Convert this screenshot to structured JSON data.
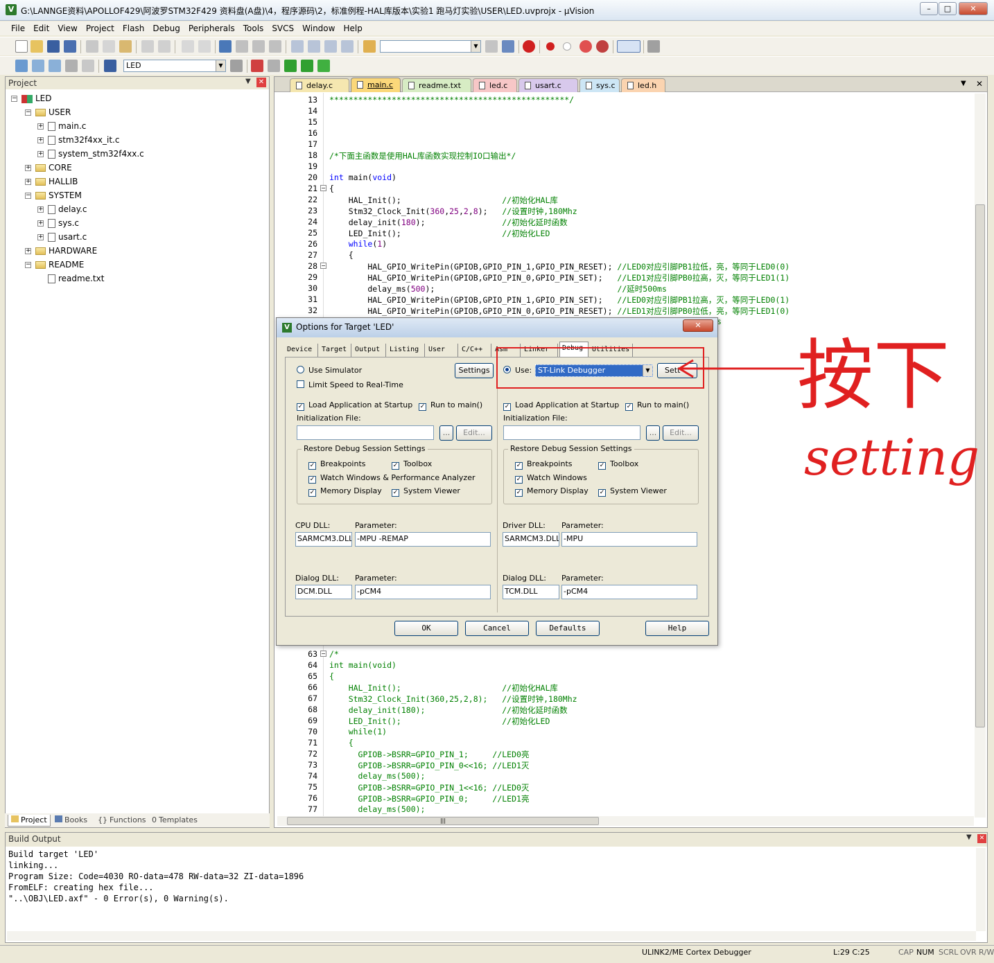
{
  "window": {
    "title": "G:\\LANNGE资料\\APOLLOF429\\阿波罗STM32F429 资料盘(A盘)\\4，程序源码\\2，标准例程-HAL库版本\\实验1 跑马灯实验\\USER\\LED.uvprojx - µVision",
    "icon": "V"
  },
  "menu": [
    "File",
    "Edit",
    "View",
    "Project",
    "Flash",
    "Debug",
    "Peripherals",
    "Tools",
    "SVCS",
    "Window",
    "Help"
  ],
  "toolbar2": {
    "target": "LED"
  },
  "project": {
    "header": "Project",
    "tree": [
      {
        "label": "LED",
        "level": 0,
        "type": "root"
      },
      {
        "label": "USER",
        "level": 1,
        "type": "folder-open"
      },
      {
        "label": "main.c",
        "level": 2,
        "type": "file"
      },
      {
        "label": "stm32f4xx_it.c",
        "level": 2,
        "type": "file"
      },
      {
        "label": "system_stm32f4xx.c",
        "level": 2,
        "type": "file"
      },
      {
        "label": "CORE",
        "level": 1,
        "type": "folder"
      },
      {
        "label": "HALLIB",
        "level": 1,
        "type": "folder"
      },
      {
        "label": "SYSTEM",
        "level": 1,
        "type": "folder-open"
      },
      {
        "label": "delay.c",
        "level": 2,
        "type": "file"
      },
      {
        "label": "sys.c",
        "level": 2,
        "type": "file"
      },
      {
        "label": "usart.c",
        "level": 2,
        "type": "file"
      },
      {
        "label": "HARDWARE",
        "level": 1,
        "type": "folder"
      },
      {
        "label": "README",
        "level": 1,
        "type": "folder-open"
      },
      {
        "label": "readme.txt",
        "level": 2,
        "type": "file-plain"
      }
    ],
    "tabs": [
      "Project",
      "Books",
      "Functions",
      "Templates"
    ]
  },
  "editor": {
    "tabs": [
      {
        "label": "delay.c",
        "color": "#f5e7b0"
      },
      {
        "label": "main.c",
        "color": "#fbd87a",
        "active": true
      },
      {
        "label": "readme.txt",
        "color": "#d7ecc4"
      },
      {
        "label": "led.c",
        "color": "#f7c7c7"
      },
      {
        "label": "usart.c",
        "color": "#d8c9ec"
      },
      {
        "label": "sys.c",
        "color": "#cde6f5"
      },
      {
        "label": "led.h",
        "color": "#fbd4b0"
      }
    ],
    "lines_top": [
      {
        "n": "13",
        "t": "**************************************************/",
        "c": "cm"
      },
      {
        "n": "14",
        "t": ""
      },
      {
        "n": "15",
        "t": ""
      },
      {
        "n": "16",
        "t": ""
      },
      {
        "n": "17",
        "t": ""
      },
      {
        "n": "18",
        "t": "/*下面主函数是使用HAL库函数实现控制IO口输出*/",
        "c": "cm"
      },
      {
        "n": "19",
        "t": ""
      },
      {
        "n": "20",
        "t": "int main(void)"
      },
      {
        "n": "21",
        "t": "{"
      },
      {
        "n": "22",
        "t": "    HAL_Init();                     //初始化HAL库"
      },
      {
        "n": "23",
        "t": "    Stm32_Clock_Init(360,25,2,8);   //设置时钟,180Mhz"
      },
      {
        "n": "24",
        "t": "    delay_init(180);                //初始化延时函数"
      },
      {
        "n": "25",
        "t": "    LED_Init();                     //初始化LED"
      },
      {
        "n": "26",
        "t": "    while(1)"
      },
      {
        "n": "27",
        "t": "    {"
      },
      {
        "n": "28",
        "t": "        HAL_GPIO_WritePin(GPIOB,GPIO_PIN_1,GPIO_PIN_RESET); //LED0对应引脚PB1拉低，亮，等同于LED0(0)"
      },
      {
        "n": "29",
        "t": "        HAL_GPIO_WritePin(GPIOB,GPIO_PIN_0,GPIO_PIN_SET);   //LED1对应引脚PB0拉高，灭，等同于LED1(1)"
      },
      {
        "n": "30",
        "t": "        delay_ms(500);                                      //延时500ms"
      },
      {
        "n": "31",
        "t": "        HAL_GPIO_WritePin(GPIOB,GPIO_PIN_1,GPIO_PIN_SET);   //LED0对应引脚PB1拉高，灭，等同于LED0(1)"
      },
      {
        "n": "32",
        "t": "        HAL_GPIO_WritePin(GPIOB,GPIO_PIN_0,GPIO_PIN_RESET); //LED1对应引脚PB0拉低，亮，等同于LED1(0)"
      }
    ],
    "lines_bottom": [
      {
        "n": "63",
        "t": "/*",
        "c": "cm"
      },
      {
        "n": "64",
        "t": "int main(void)",
        "c": "cm"
      },
      {
        "n": "65",
        "t": "{",
        "c": "cm"
      },
      {
        "n": "66",
        "t": "    HAL_Init();                     //初始化HAL库",
        "c": "cm"
      },
      {
        "n": "67",
        "t": "    Stm32_Clock_Init(360,25,2,8);   //设置时钟,180Mhz",
        "c": "cm"
      },
      {
        "n": "68",
        "t": "    delay_init(180);                //初始化延时函数",
        "c": "cm"
      },
      {
        "n": "69",
        "t": "    LED_Init();                     //初始化LED",
        "c": "cm"
      },
      {
        "n": "70",
        "t": "    while(1)",
        "c": "cm"
      },
      {
        "n": "71",
        "t": "    {",
        "c": "cm"
      },
      {
        "n": "72",
        "t": "      GPIOB->BSRR=GPIO_PIN_1;     //LED0亮",
        "c": "cm"
      },
      {
        "n": "73",
        "t": "      GPIOB->BSRR=GPIO_PIN_0<<16; //LED1灭",
        "c": "cm"
      },
      {
        "n": "74",
        "t": "      delay_ms(500);",
        "c": "cm"
      },
      {
        "n": "75",
        "t": "      GPIOB->BSRR=GPIO_PIN_1<<16; //LED0灭",
        "c": "cm"
      },
      {
        "n": "76",
        "t": "      GPIOB->BSRR=GPIO_PIN_0;     //LED1亮",
        "c": "cm"
      },
      {
        "n": "77",
        "t": "      delay_ms(500);",
        "c": "cm"
      }
    ],
    "overflow_fragment": "s"
  },
  "dialog": {
    "title": "Options for Target 'LED'",
    "close": "✕",
    "tabs": [
      "Device",
      "Target",
      "Output",
      "Listing",
      "User",
      "C/C++",
      "Asm",
      "Linker",
      "Debug",
      "Utilities"
    ],
    "left": {
      "use_simulator": "Use Simulator",
      "settings": "Settings",
      "limit_speed": "Limit Speed to Real-Time",
      "load_app": "Load Application at Startup",
      "run_to_main": "Run to main()",
      "init_file": "Initialization File:",
      "browse": "...",
      "edit": "Edit...",
      "restore_title": "Restore Debug Session Settings",
      "breakpoints": "Breakpoints",
      "toolbox": "Toolbox",
      "watch": "Watch Windows & Performance Analyzer",
      "memory": "Memory Display",
      "sysviewer": "System Viewer",
      "cpu_dll_label": "CPU DLL:",
      "param_label": "Parameter:",
      "cpu_dll": "SARMCM3.DLL",
      "cpu_param": "-MPU -REMAP",
      "dialog_dll_label": "Dialog DLL:",
      "dialog_dll": "DCM.DLL",
      "dialog_param": "-pCM4"
    },
    "right": {
      "use": "Use:",
      "debugger": "ST-Link Debugger",
      "settings": "Sett",
      "load_app": "Load Application at Startup",
      "run_to_main": "Run to main()",
      "init_file": "Initialization File:",
      "browse": "...",
      "edit": "Edit...",
      "restore_title": "Restore Debug Session Settings",
      "breakpoints": "Breakpoints",
      "toolbox": "Toolbox",
      "watch": "Watch Windows",
      "memory": "Memory Display",
      "sysviewer": "System Viewer",
      "driver_dll_label": "Driver DLL:",
      "param_label": "Parameter:",
      "driver_dll": "SARMCM3.DLL",
      "driver_param": "-MPU",
      "dialog_dll_label": "Dialog DLL:",
      "dialog_dll": "TCM.DLL",
      "dialog_param": "-pCM4"
    },
    "buttons": {
      "ok": "OK",
      "cancel": "Cancel",
      "defaults": "Defaults",
      "help": "Help"
    }
  },
  "annotation": {
    "word1": "按下",
    "word2": "setting",
    "color": "#e02020"
  },
  "build": {
    "header": "Build Output",
    "lines": [
      "Build target 'LED'",
      "linking...",
      "Program Size: Code=4030 RO-data=478 RW-data=32 ZI-data=1896",
      "FromELF: creating hex file...",
      "\"..\\OBJ\\LED.axf\" - 0 Error(s), 0 Warning(s)."
    ]
  },
  "status": {
    "debugger": "ULINK2/ME Cortex Debugger",
    "pos": "L:29 C:25",
    "cap": "CAP",
    "num": "NUM",
    "scrl": "SCRL",
    "ovr": "OVR",
    "rw": "R/W"
  }
}
